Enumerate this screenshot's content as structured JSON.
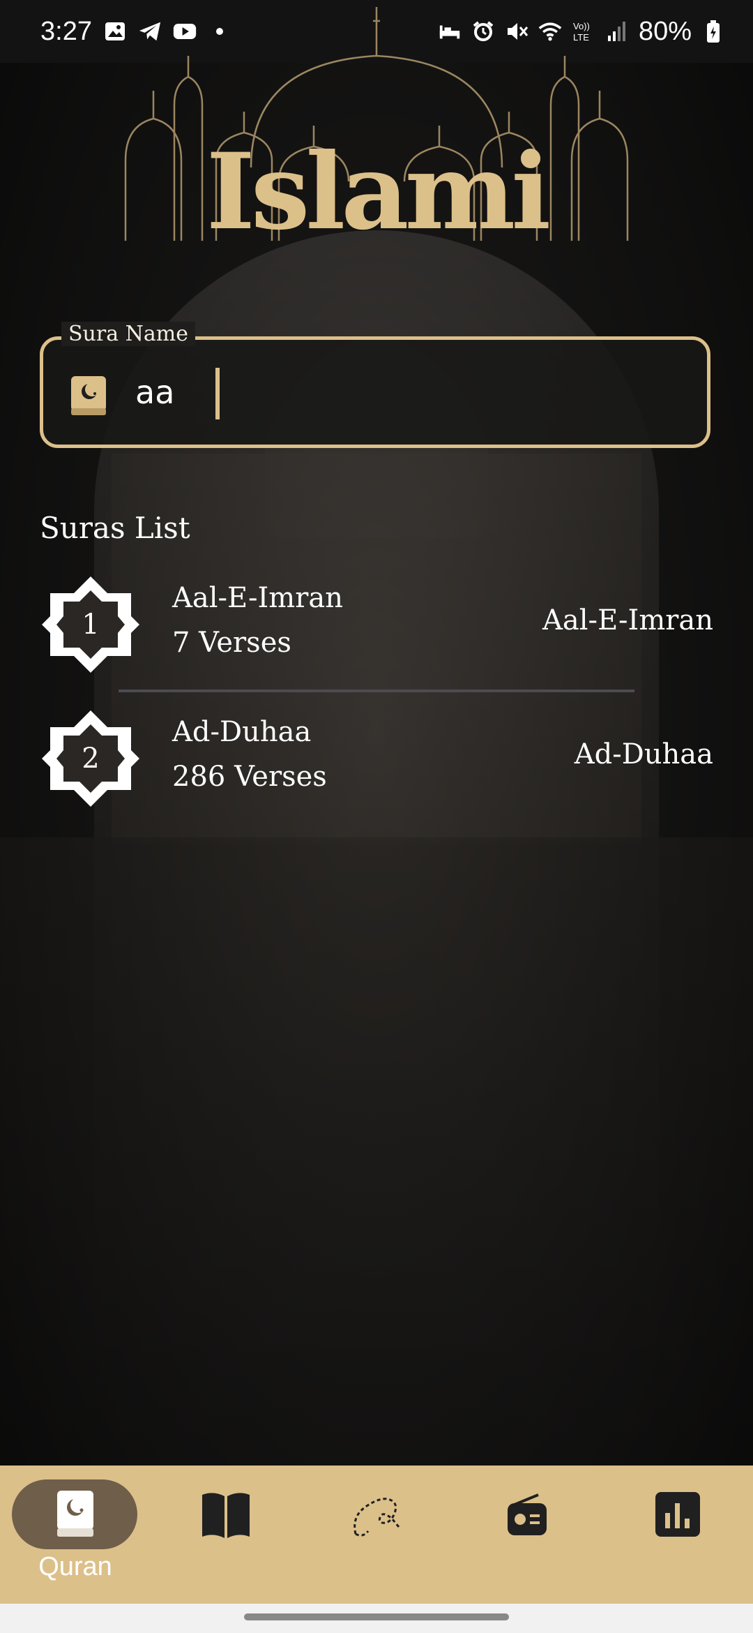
{
  "status_bar": {
    "time": "3:27",
    "battery": "80%",
    "left_icons": [
      "gallery-icon",
      "telegram-icon",
      "youtube-icon",
      "dot-icon"
    ],
    "right_icons": [
      "sleep-icon",
      "alarm-icon",
      "mute-icon",
      "wifi-icon",
      "volte-icon",
      "signal-icon",
      "battery-icon"
    ]
  },
  "header": {
    "logo_text": "Islami"
  },
  "search": {
    "label": "Sura Name",
    "value": "aa",
    "icon": "quran-book-icon"
  },
  "section_title": "Suras List",
  "suras": [
    {
      "number": "1",
      "name_en": "Aal-E-Imran",
      "verses": "7 Verses",
      "name_ar": "Aal-E-Imran"
    },
    {
      "number": "2",
      "name_en": "Ad-Duhaa",
      "verses": "286 Verses",
      "name_ar": "Ad-Duhaa"
    }
  ],
  "bottom_nav": {
    "items": [
      {
        "label": "Quran",
        "icon": "quran-icon",
        "active": true
      },
      {
        "label": "",
        "icon": "hadith-book-icon",
        "active": false
      },
      {
        "label": "",
        "icon": "sebha-icon",
        "active": false
      },
      {
        "label": "",
        "icon": "radio-icon",
        "active": false
      },
      {
        "label": "",
        "icon": "time-chart-icon",
        "active": false
      }
    ]
  },
  "colors": {
    "accent": "#dcc08a",
    "background": "#1c1b1a",
    "active_pill": "#6f5e49",
    "text": "#ffffff"
  }
}
